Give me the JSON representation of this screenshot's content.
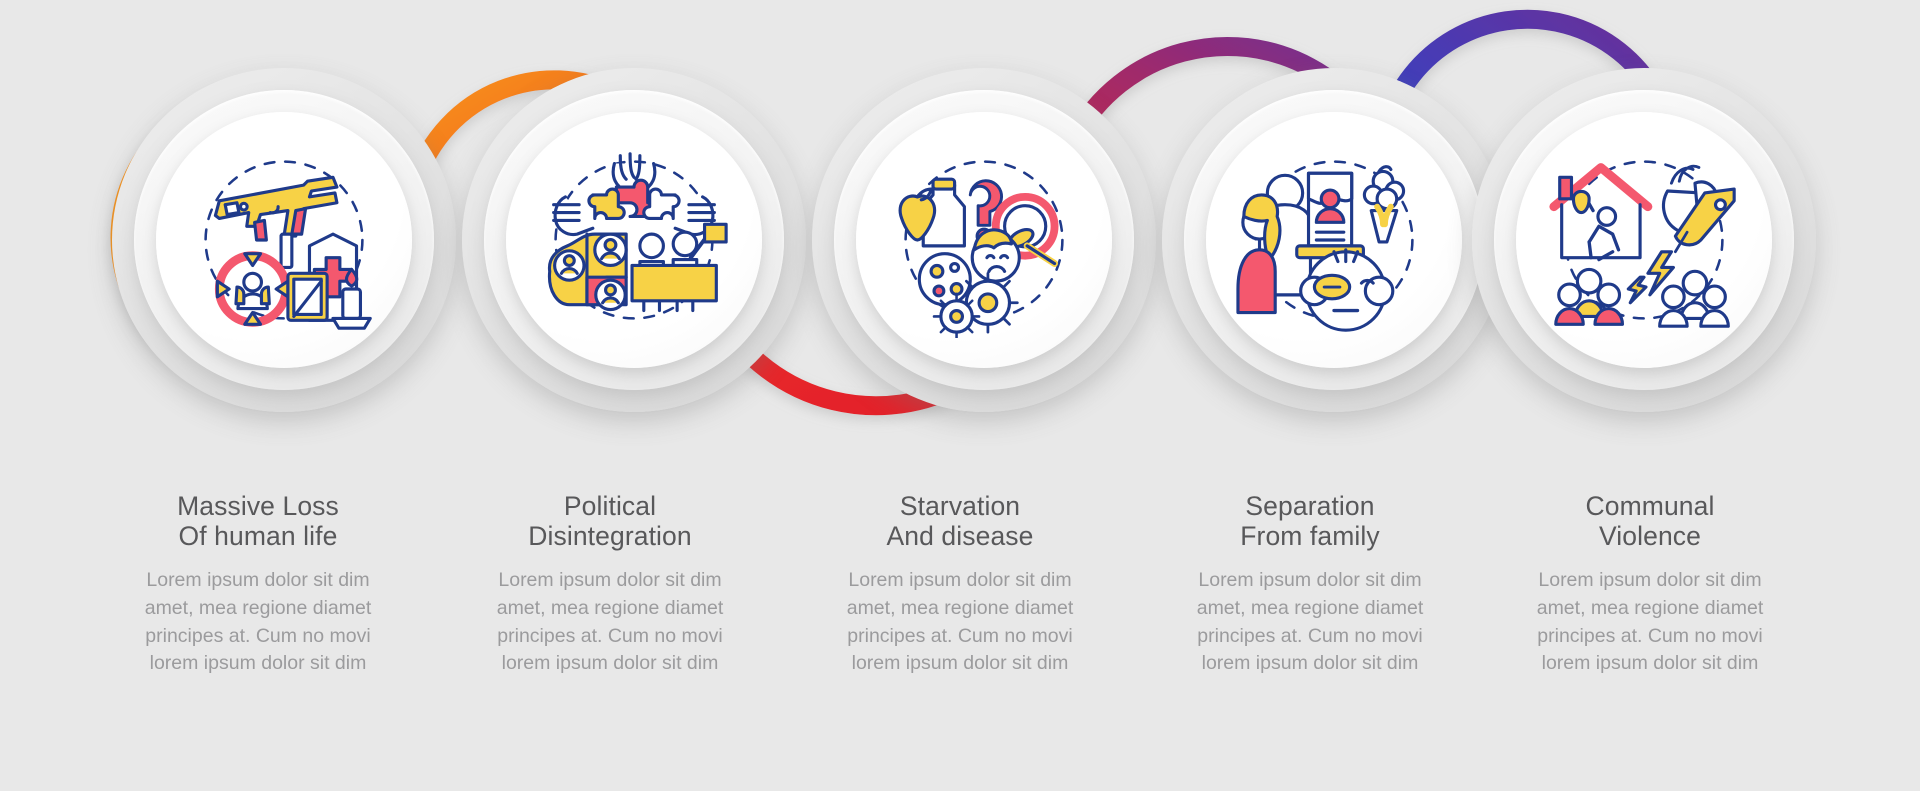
{
  "page": {
    "background_color": "#e8e8e8",
    "type": "loop-infographic",
    "step_count": 5
  },
  "palette": {
    "orange": "#F7941D",
    "orange_deep": "#F26722",
    "red": "#EE2D24",
    "crimson": "#D1243D",
    "purple": "#6B3098",
    "blue": "#2B50C8",
    "icon_navy": "#1F3A8A",
    "icon_yellow": "#F7D246",
    "icon_pink": "#F4586E",
    "title_color": "#58585a",
    "body_color": "#9b9b9d"
  },
  "body_text": "Lorem ipsum dolor sit dim\namet, mea regione diamet\nprincipes at. Cum no movi\nlorem ipsum dolor sit dim",
  "steps": [
    {
      "index": 1,
      "title": "Massive Loss\nOf human life",
      "body": "Lorem ipsum dolor sit dim\namet, mea regione diamet\nprincipes at. Cum no movi\nlorem ipsum dolor sit dim",
      "icon_name": "massive-loss-of-human-life-icon",
      "icon_elements": [
        "submachine-gun",
        "coffin-with-cross",
        "candle",
        "picture-frame",
        "people-group-cycle-arrows"
      ],
      "ring_color_start": "#F7941D",
      "ring_color_end": "#F7941D"
    },
    {
      "index": 2,
      "title": "Political\nDisintegration",
      "body": "Lorem ipsum dolor sit dim\namet, mea regione diamet\nprincipes at. Cum no movi\nlorem ipsum dolor sit dim",
      "icon_name": "political-disintegration-icon",
      "icon_elements": [
        "hands-with-puzzle-pieces",
        "divided-map-with-avatars",
        "protesters-with-flag-and-barricade"
      ],
      "ring_color_start": "#F7941D",
      "ring_color_end": "#EE2D24"
    },
    {
      "index": 3,
      "title": "Starvation\nAnd disease",
      "body": "Lorem ipsum dolor sit dim\namet, mea regione diamet\nprincipes at. Cum no movi\nlorem ipsum dolor sit dim",
      "icon_name": "starvation-and-disease-icon",
      "icon_elements": [
        "apple",
        "milk-carton",
        "question-mark",
        "virus-germs",
        "sad-child-with-empty-plate-and-spoon"
      ],
      "ring_color_start": "#EE2D24",
      "ring_color_end": "#EE2D24"
    },
    {
      "index": 4,
      "title": "Separation\nFrom family",
      "body": "Lorem ipsum dolor sit dim\namet, mea regione diamet\nprincipes at. Cum no movi\nlorem ipsum dolor sit dim",
      "icon_name": "separation-from-family-icon",
      "icon_elements": [
        "grieving-couple",
        "memorial-portrait-stand",
        "flower-bouquet",
        "crying-baby-face"
      ],
      "ring_color_start": "#D1243D",
      "ring_color_end": "#6B3098"
    },
    {
      "index": 5,
      "title": "Communal\nViolence",
      "body": "Lorem ipsum dolor sit dim\namet, mea regione diamet\nprincipes at. Cum no movi\nlorem ipsum dolor sit dim",
      "icon_name": "communal-violence-icon",
      "icon_elements": [
        "house-with-looter",
        "hand-holding-price-tag",
        "lightning-bolts",
        "two-opposing-crowds"
      ],
      "ring_color_start": "#6B3098",
      "ring_color_end": "#2B50C8"
    }
  ]
}
